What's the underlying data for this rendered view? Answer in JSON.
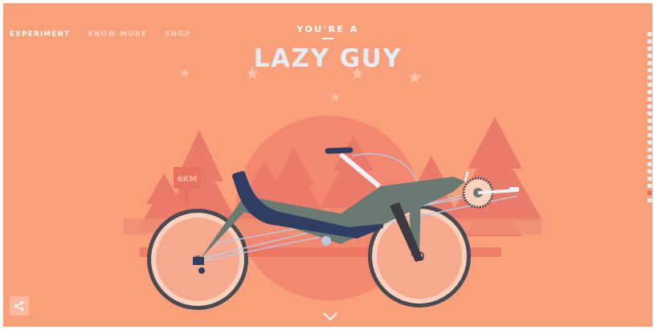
{
  "nav": {
    "items": [
      {
        "label": "EXPERIMENT",
        "active": true
      },
      {
        "label": "KNOW MORE",
        "active": false
      },
      {
        "label": "SHOP",
        "active": false
      }
    ]
  },
  "hero": {
    "kicker": "YOU'RE A",
    "title": "LAZY GUY"
  },
  "sign": {
    "distance": "6KM"
  },
  "scroll_indicator": {
    "count": 24,
    "active_index": 22
  },
  "colors": {
    "background": "#f99f7a",
    "sun": "#f3876f",
    "trees": "#ea7a6a",
    "bike_frame": "#6a7a72",
    "seat": "#2f3d63",
    "tire": "#4a4a52",
    "rim": "#fcd2bf",
    "title": "#e3ecf7"
  },
  "icons": {
    "share": "share-icon",
    "scroll_down": "chevron-down-icon"
  }
}
